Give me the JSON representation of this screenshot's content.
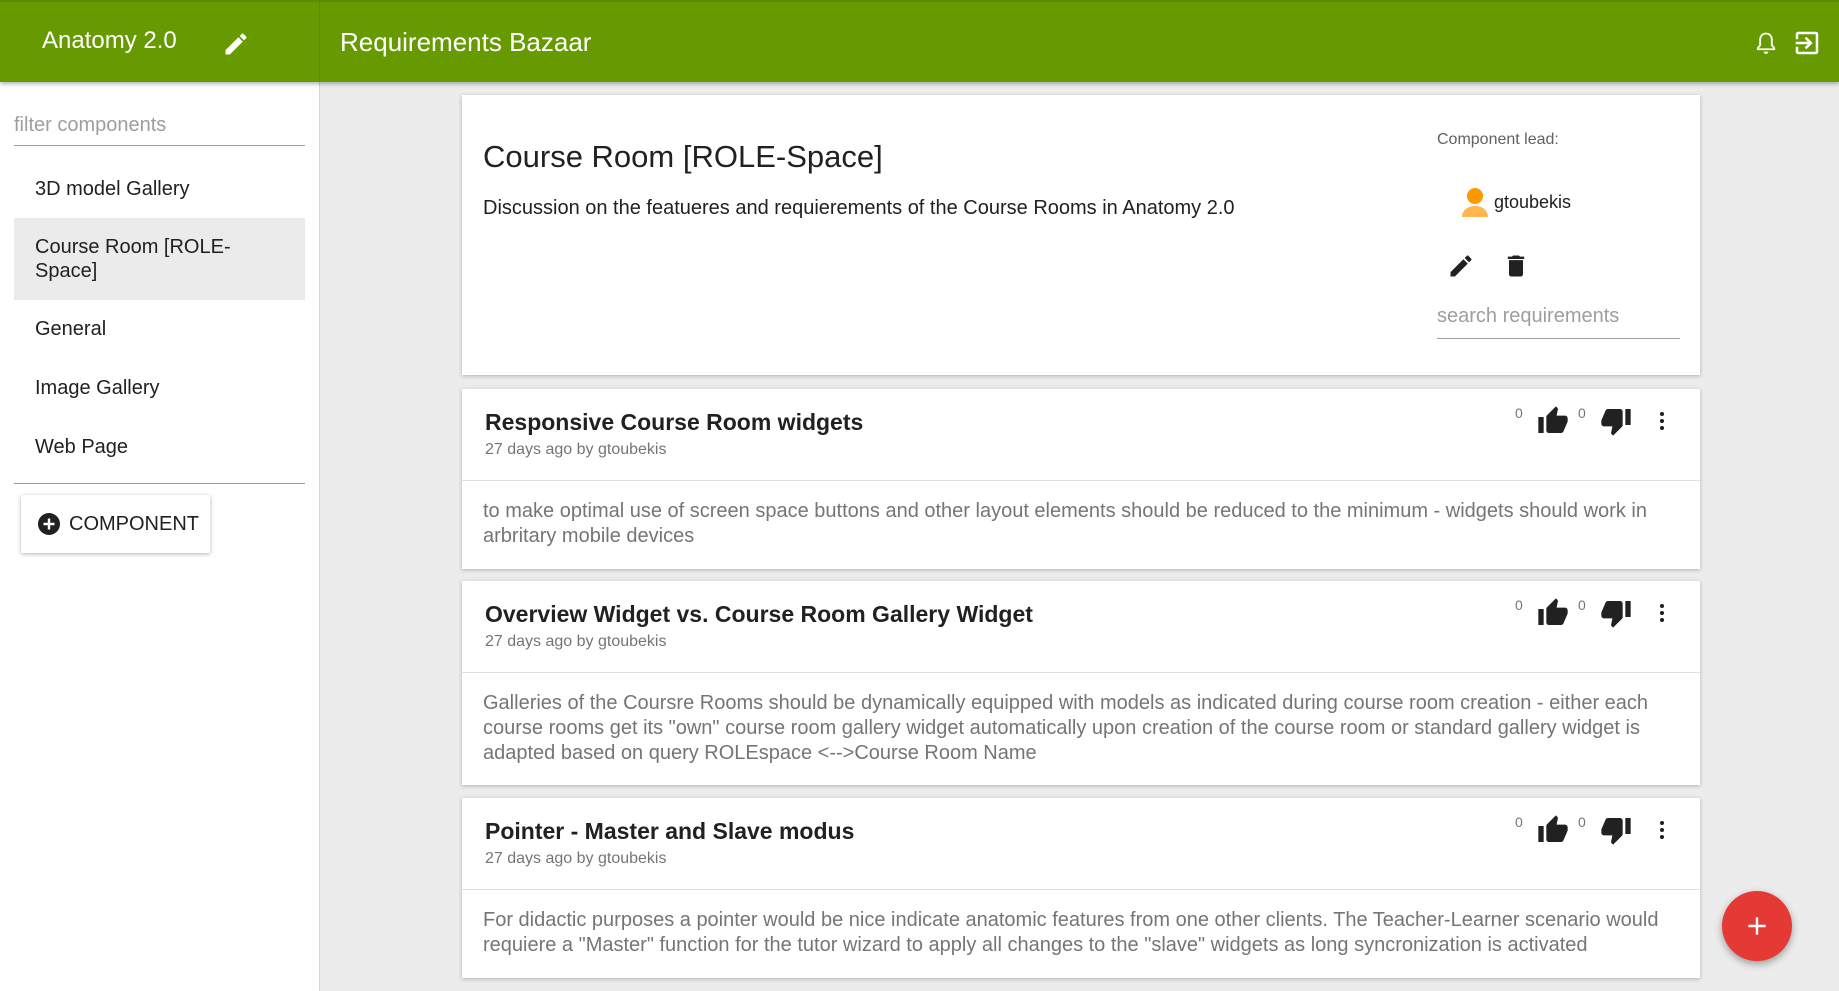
{
  "header": {
    "project_title": "Anatomy 2.0",
    "app_title": "Requirements Bazaar",
    "icons": [
      "edit-icon",
      "bell-icon",
      "logout-icon"
    ]
  },
  "sidebar": {
    "filter_placeholder": "filter components",
    "items": [
      {
        "label": "3D model Gallery",
        "selected": false
      },
      {
        "label": "Course Room [ROLE-Space]",
        "selected": true
      },
      {
        "label": "General",
        "selected": false
      },
      {
        "label": "Image Gallery",
        "selected": false
      },
      {
        "label": "Web Page",
        "selected": false
      }
    ],
    "add_button_label": "COMPONENT"
  },
  "component": {
    "title": "Course Room [ROLE-Space]",
    "description": "Discussion on the featueres and requierements of the Course Rooms in Anatomy 2.0",
    "lead_label": "Component lead:",
    "lead_name": "gtoubekis",
    "search_placeholder": "search requirements"
  },
  "requirements": [
    {
      "title": "Responsive Course Room widgets",
      "meta": "27 days ago  by gtoubekis",
      "up_votes": "0",
      "down_votes": "0",
      "body": "to make optimal use of screen space buttons and other layout elements should be reduced to the minimum - widgets should work in arbritary mobile devices"
    },
    {
      "title": "Overview Widget vs. Course Room Gallery Widget",
      "meta": "27 days ago  by gtoubekis",
      "up_votes": "0",
      "down_votes": "0",
      "body": "Galleries of the Coursre Rooms should be dynamically equipped with models as indicated during course room creation - either each course rooms get its \"own\" course room gallery widget automatically upon creation of the course room or standard gallery widget is adapted based on query ROLEspace <-->Course Room Name"
    },
    {
      "title": "Pointer - Master and Slave modus",
      "meta": "27 days ago  by gtoubekis",
      "up_votes": "0",
      "down_votes": "0",
      "body": "For didactic purposes a pointer would be nice indicate anatomic features from one other clients. The Teacher-Learner scenario would requiere a \"Master\" function for the tutor wizard to apply all changes to the \"slave\" widgets as long syncronization is activated"
    }
  ],
  "colors": {
    "primary": "#669a00",
    "accent": "#e53935",
    "background": "#ececec"
  }
}
